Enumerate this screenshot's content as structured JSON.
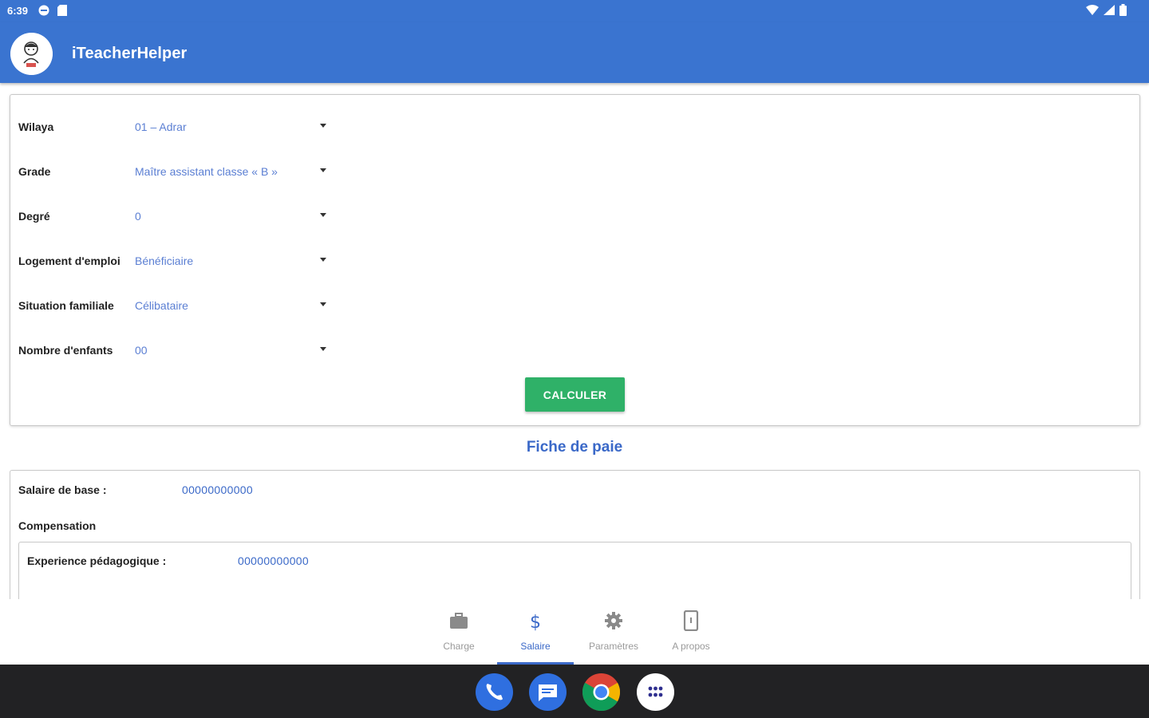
{
  "status_bar": {
    "time": "6:39"
  },
  "app": {
    "title": "iTeacherHelper"
  },
  "form": {
    "fields": [
      {
        "label": "Wilaya",
        "value": "01 – Adrar"
      },
      {
        "label": "Grade",
        "value": "Maître assistant classe « B »"
      },
      {
        "label": "Degré",
        "value": "0"
      },
      {
        "label": "Logement d'emploi",
        "value": "Bénéficiaire"
      },
      {
        "label": "Situation familiale",
        "value": "Célibataire"
      },
      {
        "label": "Nombre d'enfants",
        "value": "00"
      }
    ],
    "calculate_label": "CALCULER"
  },
  "payslip": {
    "title": "Fiche de paie",
    "base_salary_label": "Salaire de base :",
    "base_salary_value": "00000000000",
    "compensation_label": "Compensation",
    "experience_label": "Experience pédagogique :",
    "experience_value": "00000000000"
  },
  "bottom_nav": {
    "items": [
      {
        "label": "Charge",
        "icon": "briefcase-icon",
        "active": false
      },
      {
        "label": "Salaire",
        "icon": "dollar-icon",
        "active": true
      },
      {
        "label": "Paramètres",
        "icon": "gear-icon",
        "active": false
      },
      {
        "label": "A propos",
        "icon": "phone-device-icon",
        "active": false
      }
    ]
  },
  "dock": {
    "apps": [
      "phone-icon",
      "messages-icon",
      "chrome-icon",
      "app-drawer-icon"
    ]
  },
  "colors": {
    "primary": "#3a74d0",
    "accent_green": "#2fb168",
    "value_blue": "#5b7fd3"
  }
}
